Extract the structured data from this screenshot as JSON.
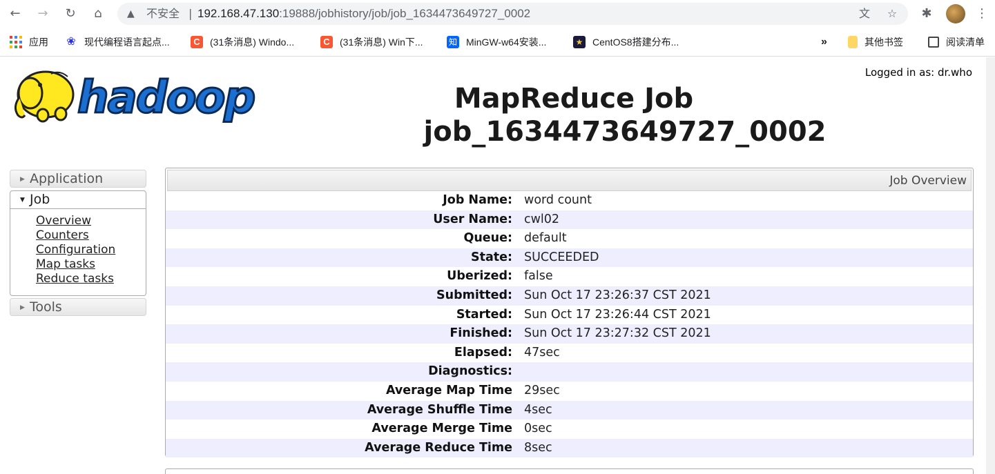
{
  "browser": {
    "insecure_label": "不安全",
    "separator": "|",
    "url_host": "192.168.47.130",
    "url_path": ":19888/jobhistory/job/job_1634473649727_0002",
    "bookmarks": [
      {
        "label": "应用",
        "icon": "apps-grid-icon"
      },
      {
        "label": "现代编程语言起点...",
        "icon": "baidu-paw-icon",
        "color": "#2932e1"
      },
      {
        "label": "(31条消息) Windo...",
        "icon": "csdn-c-icon",
        "color": "#fc5531"
      },
      {
        "label": "(31条消息) Win下...",
        "icon": "csdn-c-icon",
        "color": "#fc5531"
      },
      {
        "label": "MinGW-w64安装...",
        "icon": "zhihu-icon",
        "color": "#0066ff"
      },
      {
        "label": "CentOS8搭建分布...",
        "icon": "star-dark-icon",
        "color": "#1a1a3a"
      }
    ],
    "overflow": "»",
    "other_bookmarks": "其他书签",
    "reading_list": "阅读清单"
  },
  "header": {
    "logged_in": "Logged in as: dr.who",
    "title_line1": "MapReduce Job",
    "title_line2": "job_1634473649727_0002",
    "logo_text": "hadoop"
  },
  "sidebar": {
    "application": "Application",
    "job": "Job",
    "job_links": [
      "Overview",
      "Counters",
      "Configuration",
      "Map tasks",
      "Reduce tasks"
    ],
    "tools": "Tools"
  },
  "overview": {
    "heading": "Job Overview",
    "rows": [
      {
        "key": "Job Name:",
        "value": "word count"
      },
      {
        "key": "User Name:",
        "value": "cwl02"
      },
      {
        "key": "Queue:",
        "value": "default"
      },
      {
        "key": "State:",
        "value": "SUCCEEDED"
      },
      {
        "key": "Uberized:",
        "value": "false"
      },
      {
        "key": "Submitted:",
        "value": "Sun Oct 17 23:26:37 CST 2021"
      },
      {
        "key": "Started:",
        "value": "Sun Oct 17 23:26:44 CST 2021"
      },
      {
        "key": "Finished:",
        "value": "Sun Oct 17 23:27:32 CST 2021"
      },
      {
        "key": "Elapsed:",
        "value": "47sec"
      },
      {
        "key": "Diagnostics:",
        "value": ""
      },
      {
        "key": "Average Map Time",
        "value": "29sec"
      },
      {
        "key": "Average Shuffle Time",
        "value": "4sec"
      },
      {
        "key": "Average Merge Time",
        "value": "0sec"
      },
      {
        "key": "Average Reduce Time",
        "value": "8sec"
      }
    ]
  },
  "colors": {
    "row_alt": "#eeeeff",
    "logo_blue": "#1a6fd0",
    "logo_yellow": "#ffe81f"
  }
}
